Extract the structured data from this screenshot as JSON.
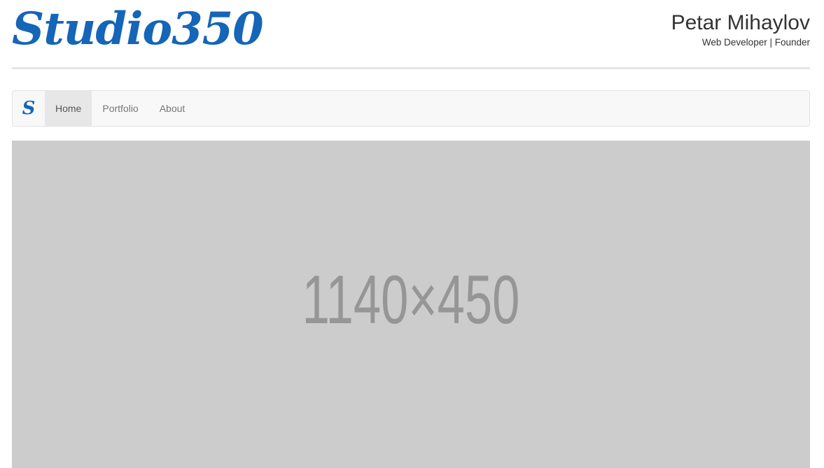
{
  "header": {
    "logo_text": "Studio350",
    "owner_name": "Petar Mihaylov",
    "owner_role": "Web Developer | Founder"
  },
  "navbar": {
    "brand_text": "S",
    "items": [
      {
        "label": "Home",
        "active": true
      },
      {
        "label": "Portfolio",
        "active": false
      },
      {
        "label": "About",
        "active": false
      }
    ]
  },
  "hero": {
    "placeholder_text": "1140×450"
  },
  "colors": {
    "brand": "#1565b8",
    "hero_background": "#cccccc",
    "hero_text": "#969696"
  }
}
